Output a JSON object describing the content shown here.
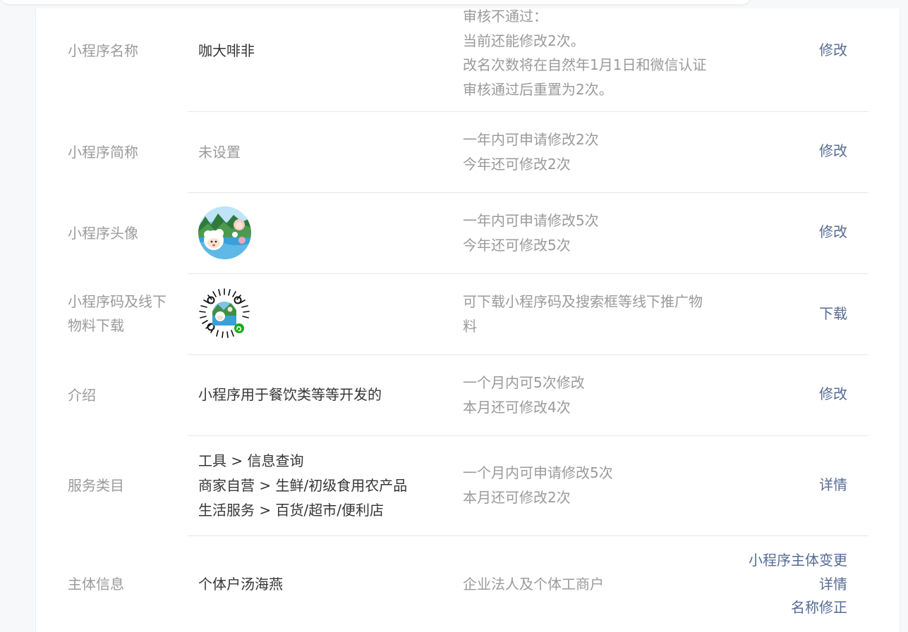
{
  "rows": [
    {
      "label": "小程序名称",
      "value": "咖大啡非",
      "desc": [
        "审核不通过：",
        "当前还能修改2次。",
        "改名次数将在自然年1月1日和微信认证",
        "审核通过后重置为2次。"
      ],
      "actions": [
        "修改"
      ]
    },
    {
      "label": "小程序简称",
      "value": "未设置",
      "desc": [
        "一年内可申请修改2次",
        "今年还可修改2次"
      ],
      "actions": [
        "修改"
      ]
    },
    {
      "label": "小程序头像",
      "desc": [
        "一年内可申请修改5次",
        "今年还可修改5次"
      ],
      "actions": [
        "修改"
      ]
    },
    {
      "label_lines": [
        "小程序码及线下",
        "物料下载"
      ],
      "desc": [
        "可下载小程序码及搜索框等线下推广物",
        "料"
      ],
      "actions": [
        "下载"
      ]
    },
    {
      "label": "介绍",
      "value": "小程序用于餐饮类等等开发的",
      "desc": [
        "一个月内可5次修改",
        "本月还可修改4次"
      ],
      "actions": [
        "修改"
      ]
    },
    {
      "label": "服务类目",
      "value_lines": [
        "工具 > 信息查询",
        "商家自营 > 生鲜/初级食用农产品",
        "生活服务 > 百货/超市/便利店"
      ],
      "desc": [
        "一个月内可申请修改5次",
        "本月还可修改2次"
      ],
      "actions": [
        "详情"
      ]
    },
    {
      "label": "主体信息",
      "value": "个体户汤海燕",
      "desc": [
        "企业法人及个体工商户"
      ],
      "actions": [
        "小程序主体变更",
        "详情",
        "名称修正"
      ]
    }
  ],
  "icons": {
    "avatar": "cartoon-sheep-avatar",
    "qrcode": "mini-program-code"
  },
  "colors": {
    "label": "#9a9a9a",
    "value": "#353535",
    "link": "#576b95",
    "divider": "#e7e7eb"
  }
}
